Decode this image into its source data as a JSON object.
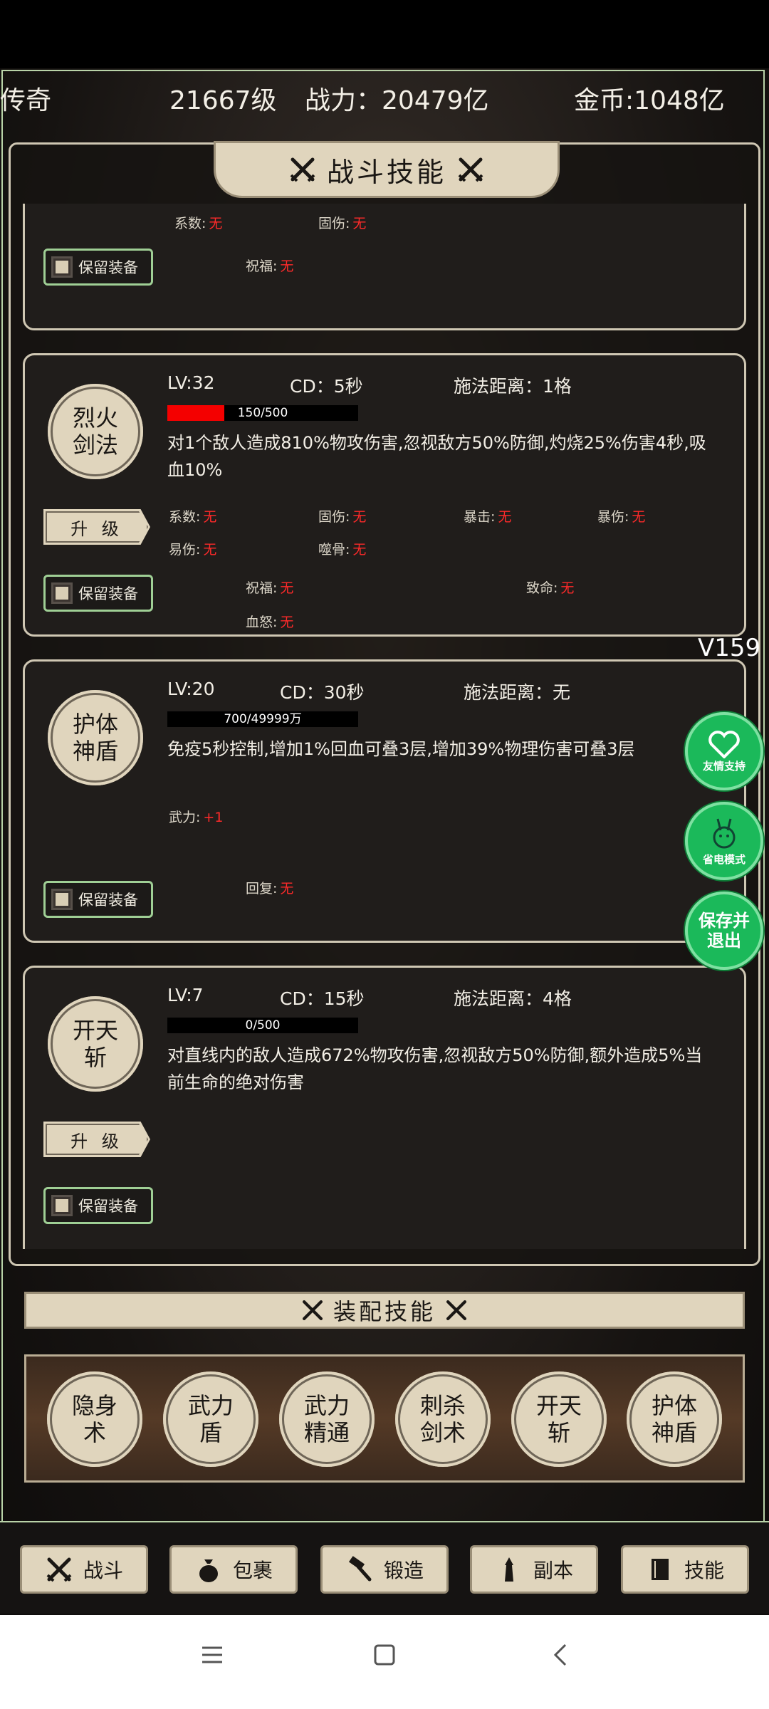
{
  "header": {
    "title_fragment": "传奇",
    "level": "21667级",
    "power": "战力：20479亿",
    "gold": "金币:1048亿"
  },
  "skills_panel": {
    "title": "战斗技能",
    "cards": [
      {
        "partial": true,
        "attrs_top": [
          "系数:",
          "无",
          "固伤:",
          "无"
        ],
        "blessing": {
          "label": "祝福:",
          "value": "无"
        },
        "keep_label": "保留装备"
      },
      {
        "medal": "烈火剑法",
        "lv": "LV:32",
        "cd": "CD：5秒",
        "range": "施法距离：1格",
        "progress": {
          "text": "150/500",
          "value": 150,
          "max": 500
        },
        "desc": "对1个敌人造成810%物攻伤害,忽视敌方50%防御,灼烧25%伤害4秒,吸血10%",
        "upgrade_label": "升 级",
        "attrs": [
          {
            "label": "系数:",
            "value": "无"
          },
          {
            "label": "固伤:",
            "value": "无"
          },
          {
            "label": "暴击:",
            "value": "无"
          },
          {
            "label": "暴伤:",
            "value": "无"
          },
          {
            "label": "易伤:",
            "value": "无"
          },
          {
            "label": "噬骨:",
            "value": "无"
          },
          {
            "label": "祝福:",
            "value": "无"
          },
          {
            "label": "致命:",
            "value": "无"
          },
          {
            "label": "血怒:",
            "value": "无"
          }
        ],
        "keep_label": "保留装备"
      },
      {
        "medal": "护体神盾",
        "lv": "LV:20",
        "cd": "CD：30秒",
        "range": "施法距离：无",
        "progress": {
          "text": "700/49999万",
          "value": 700,
          "max": 499990000
        },
        "desc": "免疫5秒控制,增加1%回血可叠3层,增加39%物理伤害可叠3层",
        "attrs": [
          {
            "label": "武力:",
            "value": "+1"
          },
          {
            "label": "回复:",
            "value": "无"
          }
        ],
        "keep_label": "保留装备"
      },
      {
        "medal": "开天斩",
        "lv": "LV:7",
        "cd": "CD：15秒",
        "range": "施法距离：4格",
        "progress": {
          "text": "0/500",
          "value": 0,
          "max": 500
        },
        "desc": "对直线内的敌人造成672%物攻伤害,忽视敌方50%防御,额外造成5%当前生命的绝对伤害",
        "upgrade_label": "升 级",
        "keep_label": "保留装备"
      }
    ]
  },
  "version": "V159",
  "side_buttons": {
    "support": "友情支持",
    "power_save": "省电模式",
    "save_exit": "保存并退出"
  },
  "equip": {
    "title": "装配技能",
    "slots": [
      "隐身术",
      "武力盾",
      "武力精通",
      "刺杀剑术",
      "开天斩",
      "护体神盾"
    ]
  },
  "tabs": [
    "战斗",
    "包裹",
    "锻造",
    "副本",
    "技能"
  ],
  "colors": {
    "accent_green": "#1bb95a",
    "progress_red": "#f40000",
    "plate_beige": "#e0d5bd",
    "value_red": "#ff2a2a"
  }
}
